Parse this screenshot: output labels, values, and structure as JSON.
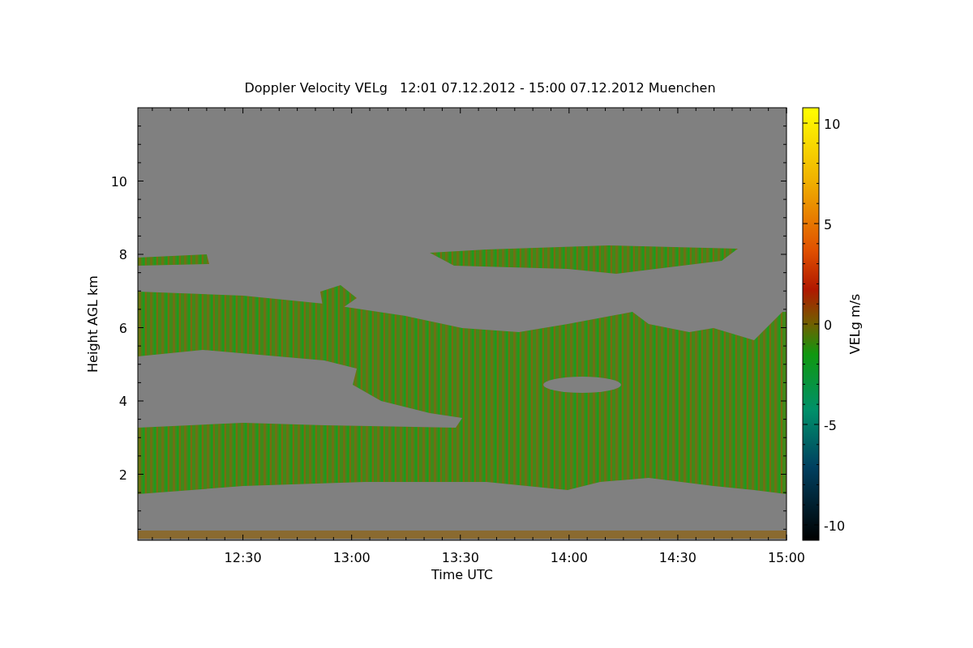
{
  "title": "Doppler Velocity VELg   12:01 07.12.2012 - 15:00 07.12.2012 Muenchen",
  "plot": {
    "xlabel": "Time UTC",
    "ylabel": "Height AGL km",
    "xticks": [
      "12:30",
      "13:00",
      "13:30",
      "14:00",
      "14:30",
      "15:00"
    ],
    "yticks": [
      "10",
      "8",
      "6",
      "4",
      "2"
    ]
  },
  "colorbar": {
    "label": "VELg m/s",
    "ticks": [
      "10",
      "5",
      "0",
      "-5",
      "-10"
    ]
  }
}
